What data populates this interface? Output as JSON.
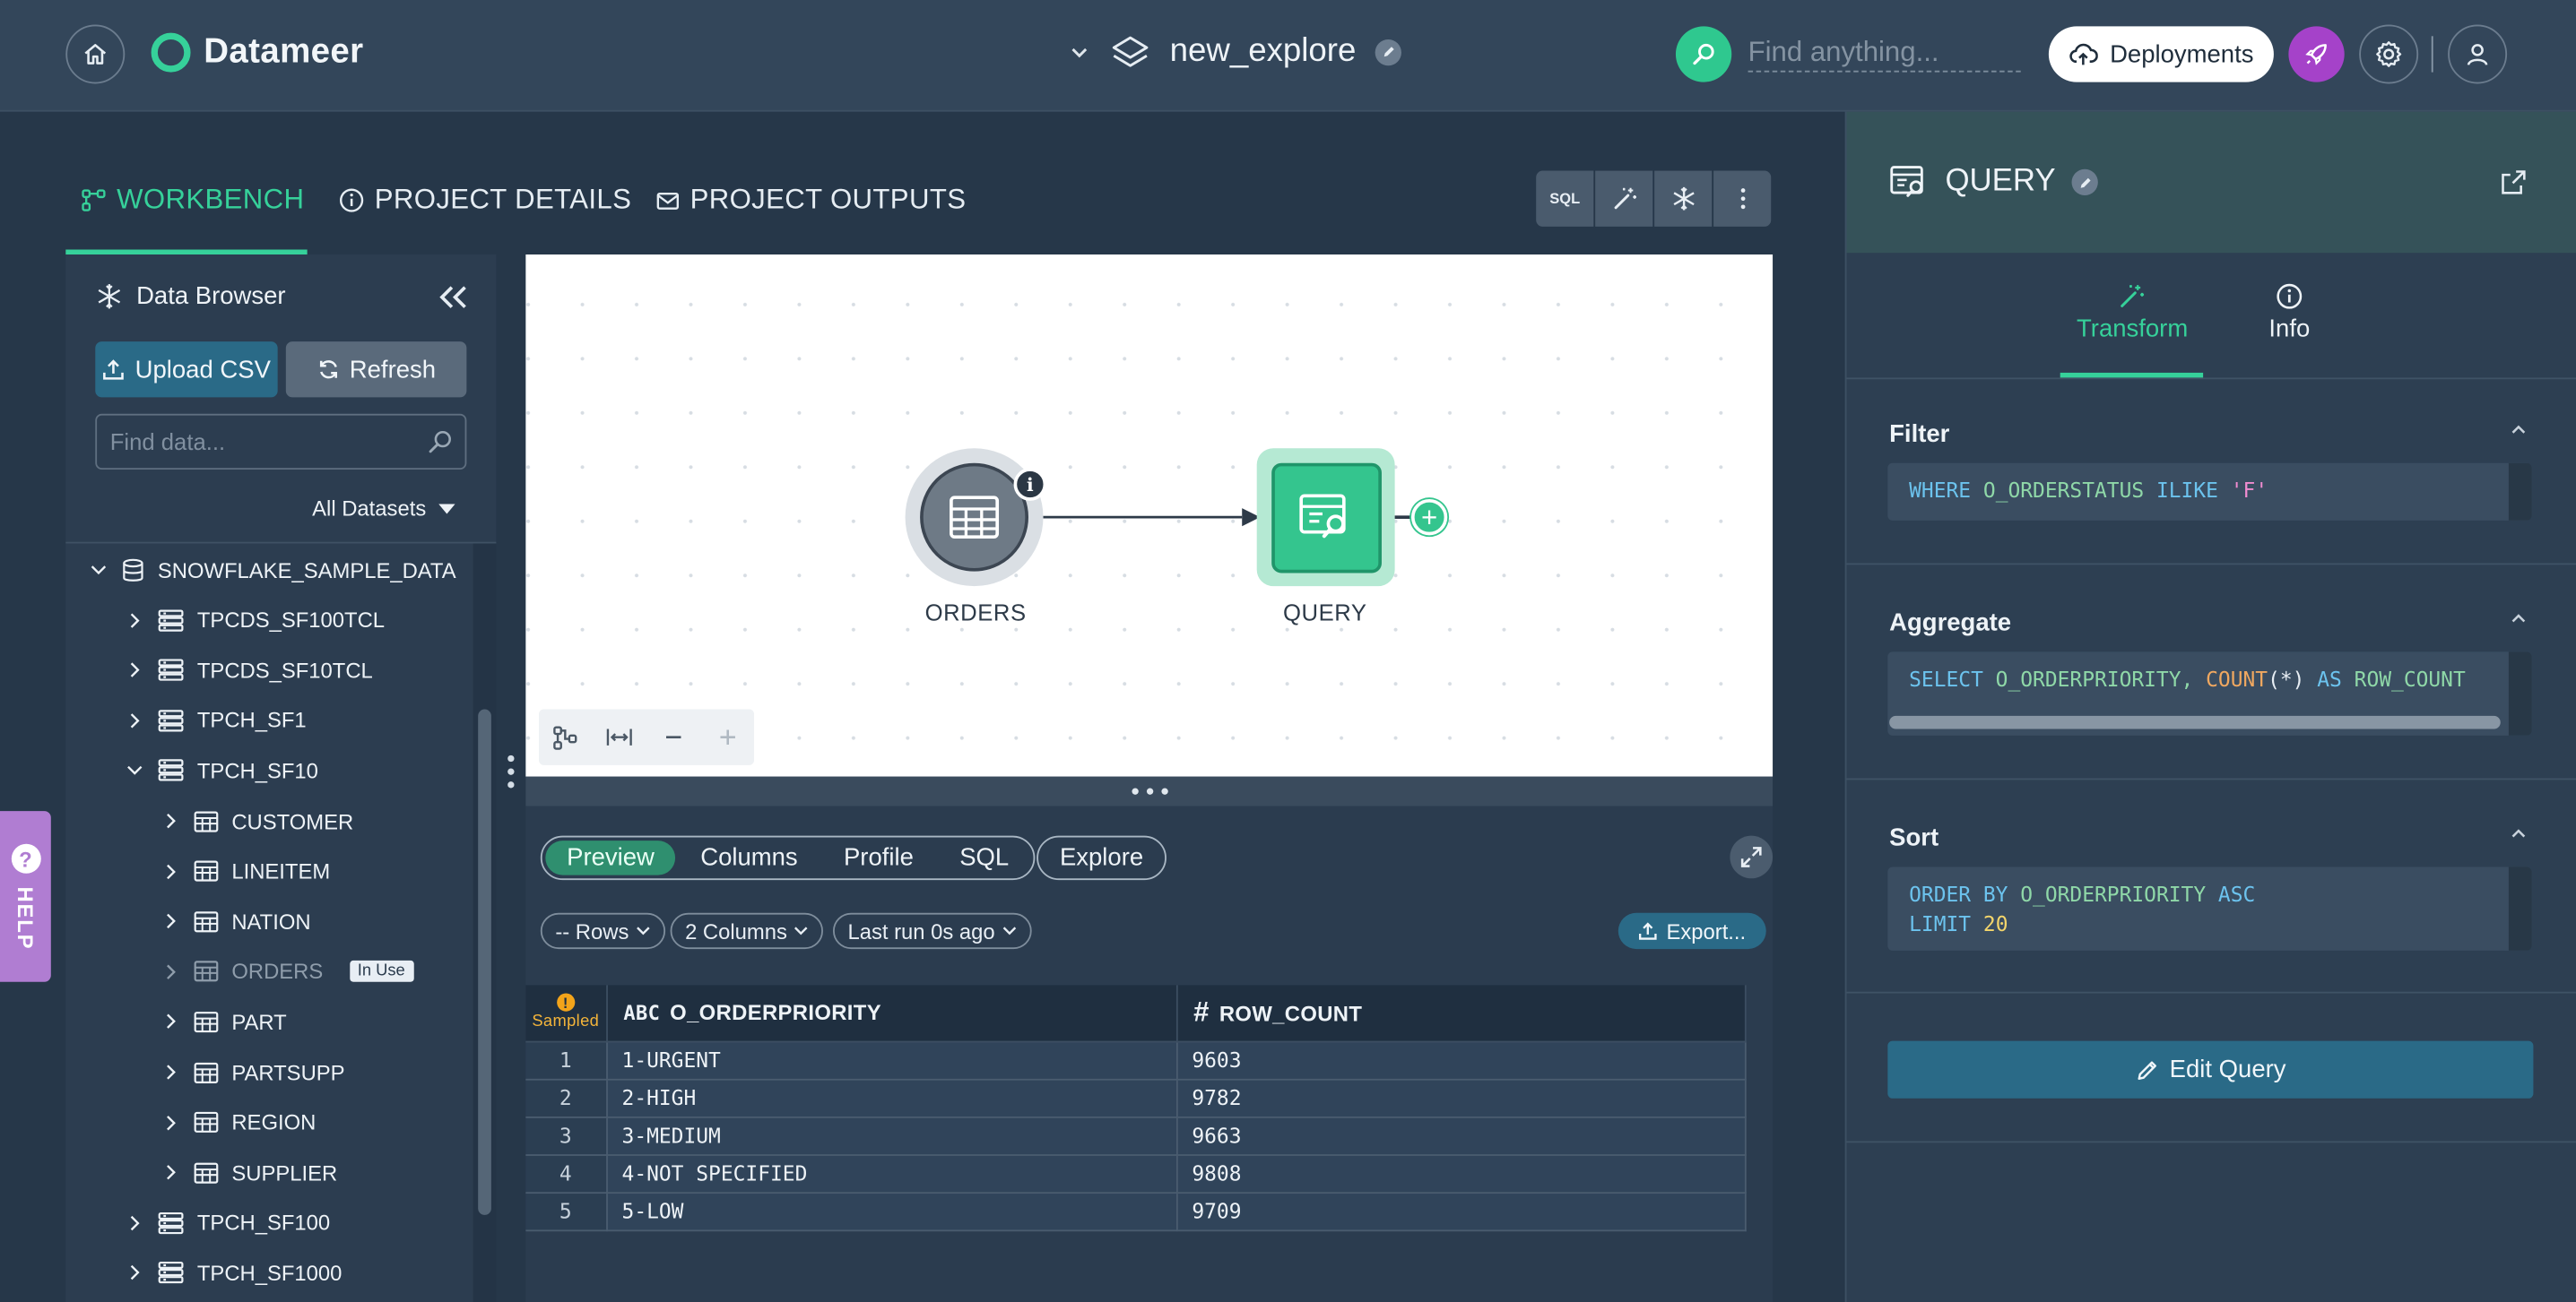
{
  "topbar": {
    "brand": "Datameer",
    "project_name": "new_explore",
    "search_placeholder": "Find anything...",
    "deployments_label": "Deployments"
  },
  "nav_tabs": [
    {
      "label": "WORKBENCH",
      "icon": "workflow-icon",
      "active": true
    },
    {
      "label": "PROJECT DETAILS",
      "icon": "info-icon",
      "active": false
    },
    {
      "label": "PROJECT OUTPUTS",
      "icon": "mail-icon",
      "active": false
    }
  ],
  "toolbar": {
    "sql_label": "SQL"
  },
  "data_browser": {
    "title": "Data Browser",
    "upload_label": "Upload CSV",
    "refresh_label": "Refresh",
    "search_placeholder": "Find data...",
    "filter_label": "All Datasets",
    "tree": [
      {
        "label": "SNOWFLAKE_SAMPLE_DATA",
        "level": 0,
        "expanded": true,
        "type": "database"
      },
      {
        "label": "TPCDS_SF100TCL",
        "level": 1,
        "expanded": false,
        "type": "schema"
      },
      {
        "label": "TPCDS_SF10TCL",
        "level": 1,
        "expanded": false,
        "type": "schema"
      },
      {
        "label": "TPCH_SF1",
        "level": 1,
        "expanded": false,
        "type": "schema"
      },
      {
        "label": "TPCH_SF10",
        "level": 1,
        "expanded": true,
        "type": "schema"
      },
      {
        "label": "CUSTOMER",
        "level": 2,
        "expanded": false,
        "type": "table"
      },
      {
        "label": "LINEITEM",
        "level": 2,
        "expanded": false,
        "type": "table"
      },
      {
        "label": "NATION",
        "level": 2,
        "expanded": false,
        "type": "table"
      },
      {
        "label": "ORDERS",
        "level": 2,
        "expanded": false,
        "type": "table",
        "badge": "In Use"
      },
      {
        "label": "PART",
        "level": 2,
        "expanded": false,
        "type": "table"
      },
      {
        "label": "PARTSUPP",
        "level": 2,
        "expanded": false,
        "type": "table"
      },
      {
        "label": "REGION",
        "level": 2,
        "expanded": false,
        "type": "table"
      },
      {
        "label": "SUPPLIER",
        "level": 2,
        "expanded": false,
        "type": "table"
      },
      {
        "label": "TPCH_SF100",
        "level": 1,
        "expanded": false,
        "type": "schema"
      },
      {
        "label": "TPCH_SF1000",
        "level": 1,
        "expanded": false,
        "type": "schema"
      }
    ]
  },
  "help_label": "HELP",
  "canvas": {
    "nodes": [
      {
        "label": "ORDERS"
      },
      {
        "label": "QUERY"
      }
    ]
  },
  "results": {
    "tabs": [
      {
        "label": "Preview",
        "active": true
      },
      {
        "label": "Columns",
        "active": false
      },
      {
        "label": "Profile",
        "active": false
      },
      {
        "label": "SQL",
        "active": false
      }
    ],
    "explore_label": "Explore",
    "rows_label": "-- Rows",
    "columns_label": "2 Columns",
    "last_run_label": "Last run 0s ago",
    "export_label": "Export...",
    "sampled_label": "Sampled",
    "columns": [
      {
        "type_icon": "ABC",
        "name": "O_ORDERPRIORITY"
      },
      {
        "type_icon": "#",
        "name": "ROW_COUNT"
      }
    ],
    "rows": [
      [
        "1",
        "1-URGENT",
        "9603"
      ],
      [
        "2",
        "2-HIGH",
        "9782"
      ],
      [
        "3",
        "3-MEDIUM",
        "9663"
      ],
      [
        "4",
        "4-NOT SPECIFIED",
        "9808"
      ],
      [
        "5",
        "5-LOW",
        "9709"
      ]
    ]
  },
  "query_panel": {
    "title": "QUERY",
    "tabs": [
      {
        "label": "Transform",
        "active": true
      },
      {
        "label": "Info",
        "active": false
      }
    ],
    "filter": {
      "title": "Filter",
      "code": {
        "kw1": "WHERE",
        "col": "O_ORDERSTATUS",
        "kw2": "ILIKE",
        "str": "'F'"
      }
    },
    "aggregate": {
      "title": "Aggregate",
      "code": {
        "kw1": "SELECT",
        "col": "O_ORDERPRIORITY,",
        "fn": "COUNT",
        "paren": "(*)",
        "kw2": "AS",
        "alias": "ROW_COUNT"
      }
    },
    "sort": {
      "title": "Sort",
      "code": {
        "kw1": "ORDER BY",
        "col": "O_ORDERPRIORITY",
        "kw2": "ASC",
        "kw3": "LIMIT",
        "num": "20"
      }
    },
    "edit_label": "Edit Query"
  }
}
